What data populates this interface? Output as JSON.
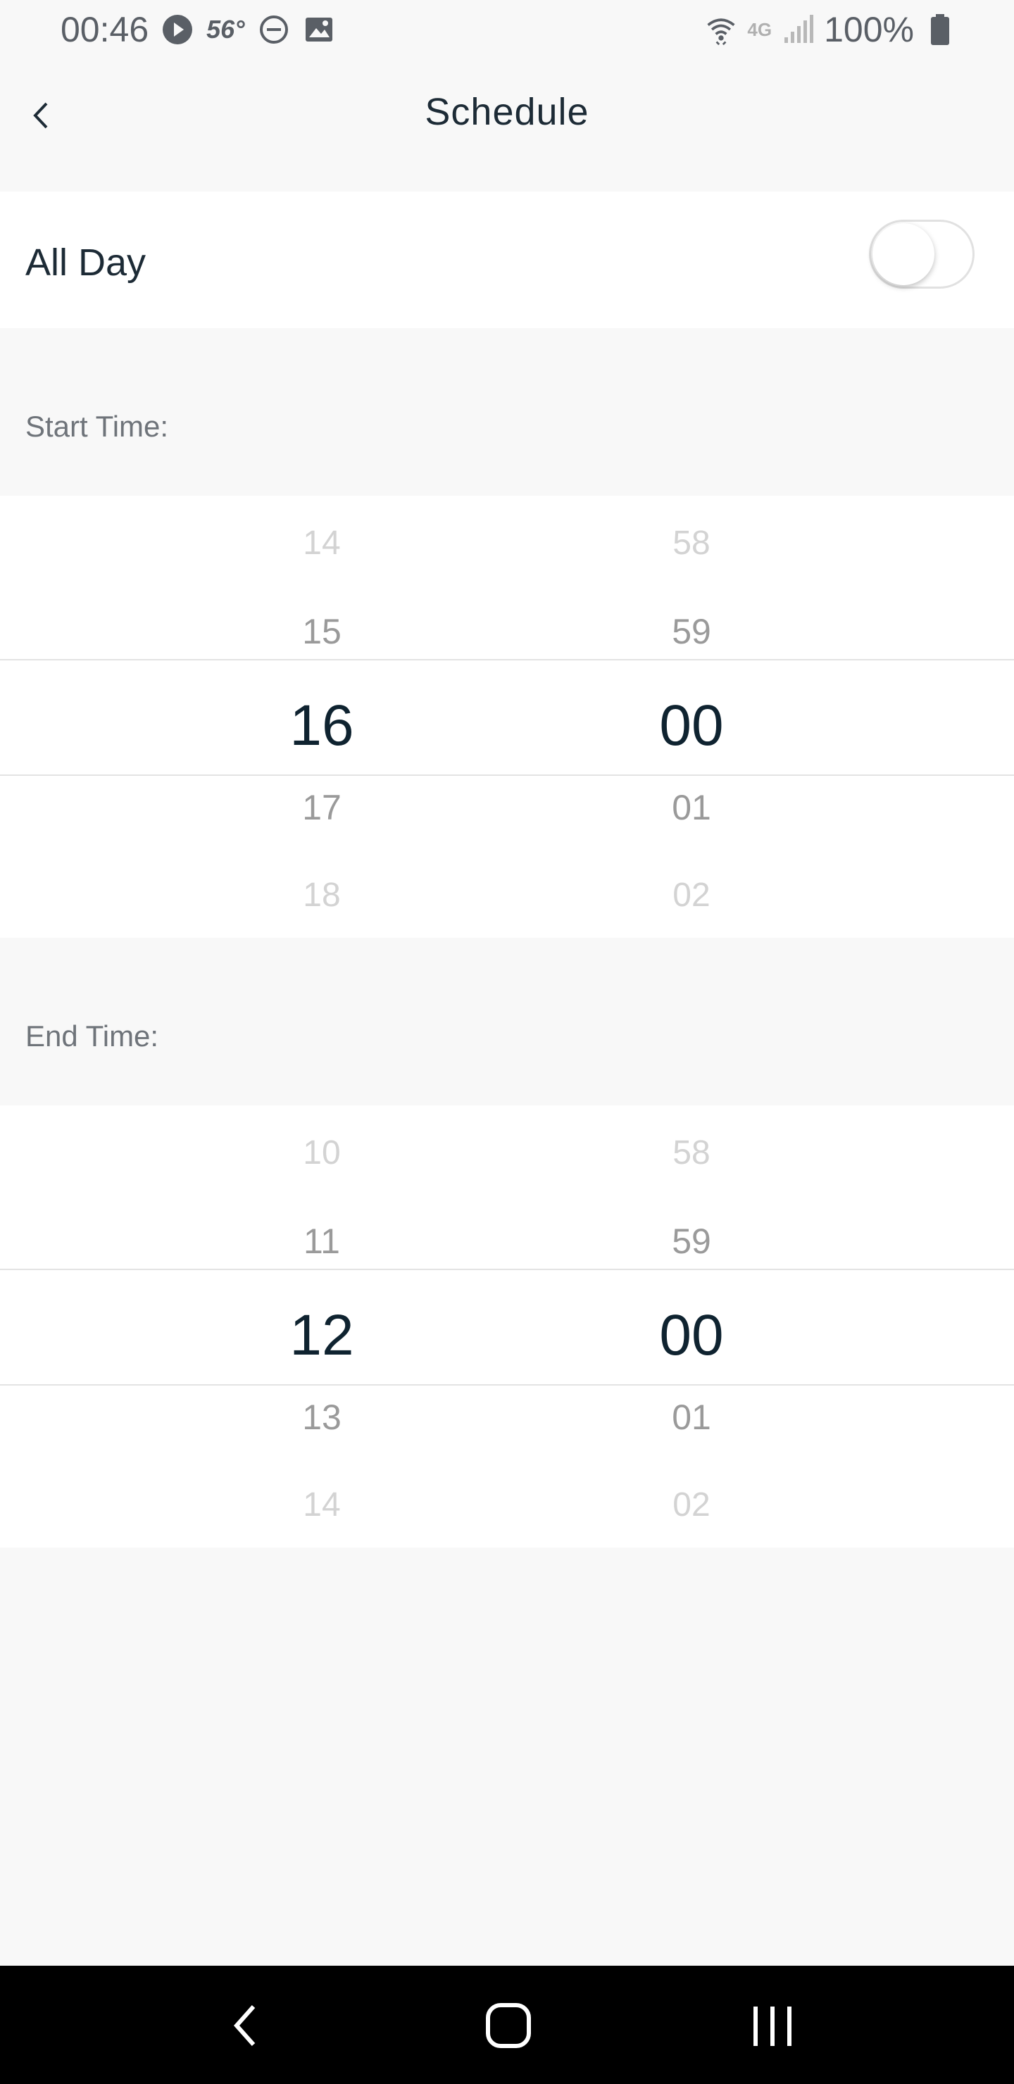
{
  "status_bar": {
    "time": "00:46",
    "temperature": "56°",
    "battery": "100%",
    "network": "4G",
    "icons": [
      "play-icon",
      "dnd-icon",
      "image-icon",
      "wifi-icon",
      "signal-icon",
      "battery-icon"
    ]
  },
  "header": {
    "title": "Schedule",
    "back_icon": "chevron-left-icon"
  },
  "all_day": {
    "label": "All Day",
    "toggle_on": false
  },
  "start_time": {
    "label": "Start Time:",
    "hours": [
      "14",
      "15",
      "16",
      "17",
      "18"
    ],
    "minutes": [
      "58",
      "59",
      "00",
      "01",
      "02"
    ],
    "selected_hour": "16",
    "selected_minute": "00"
  },
  "end_time": {
    "label": "End Time:",
    "hours": [
      "10",
      "11",
      "12",
      "13",
      "14"
    ],
    "minutes": [
      "58",
      "59",
      "00",
      "01",
      "02"
    ],
    "selected_hour": "12",
    "selected_minute": "00"
  },
  "nav_bar": {
    "icons": [
      "nav-back-icon",
      "nav-home-icon",
      "nav-recents-icon"
    ]
  },
  "colors": {
    "background": "#f8f8f8",
    "card": "#ffffff",
    "text_primary": "#1d2b36",
    "text_secondary": "#6f747a",
    "picker_selected": "#0f2330"
  }
}
